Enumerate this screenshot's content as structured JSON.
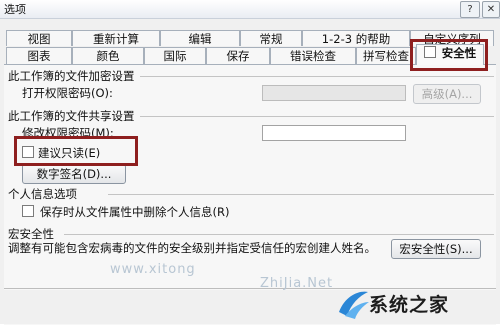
{
  "window": {
    "title": "选项",
    "help_glyph": "?",
    "close_glyph": "✕"
  },
  "tabs": {
    "row1": [
      "视图",
      "重新计算",
      "编辑",
      "常规",
      "1-2-3 的帮助",
      "自定义序列"
    ],
    "row2": [
      "图表",
      "颜色",
      "国际",
      "保存",
      "错误检查",
      "拼写检查",
      "安全性"
    ],
    "active": "安全性"
  },
  "encryption": {
    "group_title": "此工作簿的文件加密设置",
    "open_password_label": "打开权限密码(O):",
    "open_password_value": "",
    "advanced_button": "高级(A)..."
  },
  "sharing": {
    "group_title": "此工作簿的文件共享设置",
    "modify_password_label": "修改权限密码(M):",
    "modify_password_value": "",
    "read_only_label": "建议只读(E)",
    "read_only_checked": false,
    "digital_signature_button": "数字签名(D)..."
  },
  "privacy": {
    "group_title": "个人信息选项",
    "remove_info_label": "保存时从文件属性中删除个人信息(R)",
    "remove_info_checked": false
  },
  "macro": {
    "group_title": "宏安全性",
    "description": "调整有可能包含宏病毒的文件的安全级别并指定受信任的宏创建人姓名。",
    "macro_security_button": "宏安全性(S)..."
  },
  "watermark": {
    "site_text_1": "www.xitong",
    "site_text_2": "ZhiJia.Net",
    "brand_text": "系统之家"
  },
  "colors": {
    "highlight_red": "#8e1f1f",
    "logo_blue": "#2a86d6"
  }
}
